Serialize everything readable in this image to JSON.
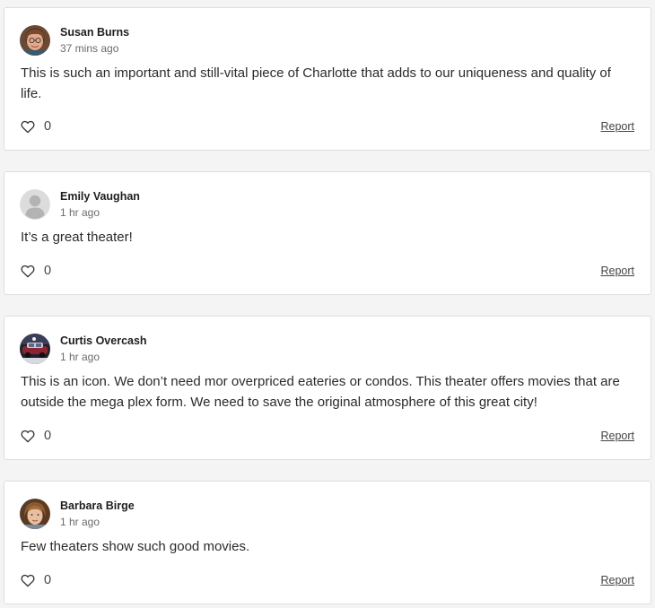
{
  "comments": [
    {
      "author": "Susan Burns",
      "time": "37 mins ago",
      "text": "This is such an important and still-vital piece of Charlotte that adds to our uniqueness and quality of life.",
      "likes": "0",
      "report_label": "Report",
      "avatar": "photo-avatar-woman-glasses"
    },
    {
      "author": "Emily Vaughan",
      "time": "1 hr ago",
      "text": "It’s a great theater!",
      "likes": "0",
      "report_label": "Report",
      "avatar": "default-avatar-placeholder"
    },
    {
      "author": "Curtis Overcash",
      "time": "1 hr ago",
      "text": "This is an icon. We don’t need mor overpriced eateries or condos. This theater offers movies that are outside the mega plex form. We need to save the original atmosphere of this great city!",
      "likes": "0",
      "report_label": "Report",
      "avatar": "photo-avatar-car"
    },
    {
      "author": "Barbara Birge",
      "time": "1 hr ago",
      "text": "Few theaters show such good movies.",
      "likes": "0",
      "report_label": "Report",
      "avatar": "photo-avatar-woman"
    }
  ],
  "colors": {
    "page_background": "#f4f4f4",
    "card_background": "#ffffff",
    "card_border": "#dedede",
    "text_primary": "#2b2b2b",
    "text_secondary": "#6b6b6b"
  }
}
